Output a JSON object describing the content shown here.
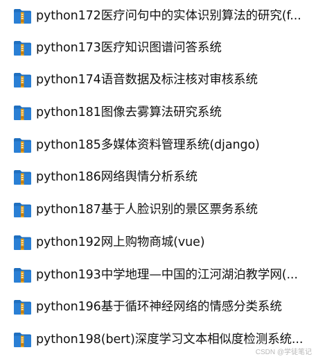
{
  "folders": [
    {
      "label": "python172医疗问句中的实体识别算法的研究(f...",
      "icon": "folder-icon"
    },
    {
      "label": "python173医疗知识图谱问答系统",
      "icon": "folder-icon"
    },
    {
      "label": "python174语音数据及标注核对审核系统",
      "icon": "folder-icon"
    },
    {
      "label": "python181图像去雾算法研究系统",
      "icon": "folder-icon"
    },
    {
      "label": "python185多媒体资料管理系统(django)",
      "icon": "folder-icon"
    },
    {
      "label": "python186网络舆情分析系统",
      "icon": "folder-icon"
    },
    {
      "label": "python187基于人脸识别的景区票务系统",
      "icon": "folder-icon"
    },
    {
      "label": "python192网上购物商城(vue)",
      "icon": "folder-icon"
    },
    {
      "label": "python193中学地理—中国的江河湖泊教学网(...",
      "icon": "folder-icon"
    },
    {
      "label": "python196基于循环神经网络的情感分类系统",
      "icon": "folder-icon"
    },
    {
      "label": "python198(bert)深度学习文本相似度检测系统...",
      "icon": "folder-icon"
    }
  ],
  "watermark": "CSDN @学徒笔记",
  "colors": {
    "folder_blue": "#2a7fd4",
    "folder_yellow": "#e9a21a",
    "text": "#111111"
  }
}
